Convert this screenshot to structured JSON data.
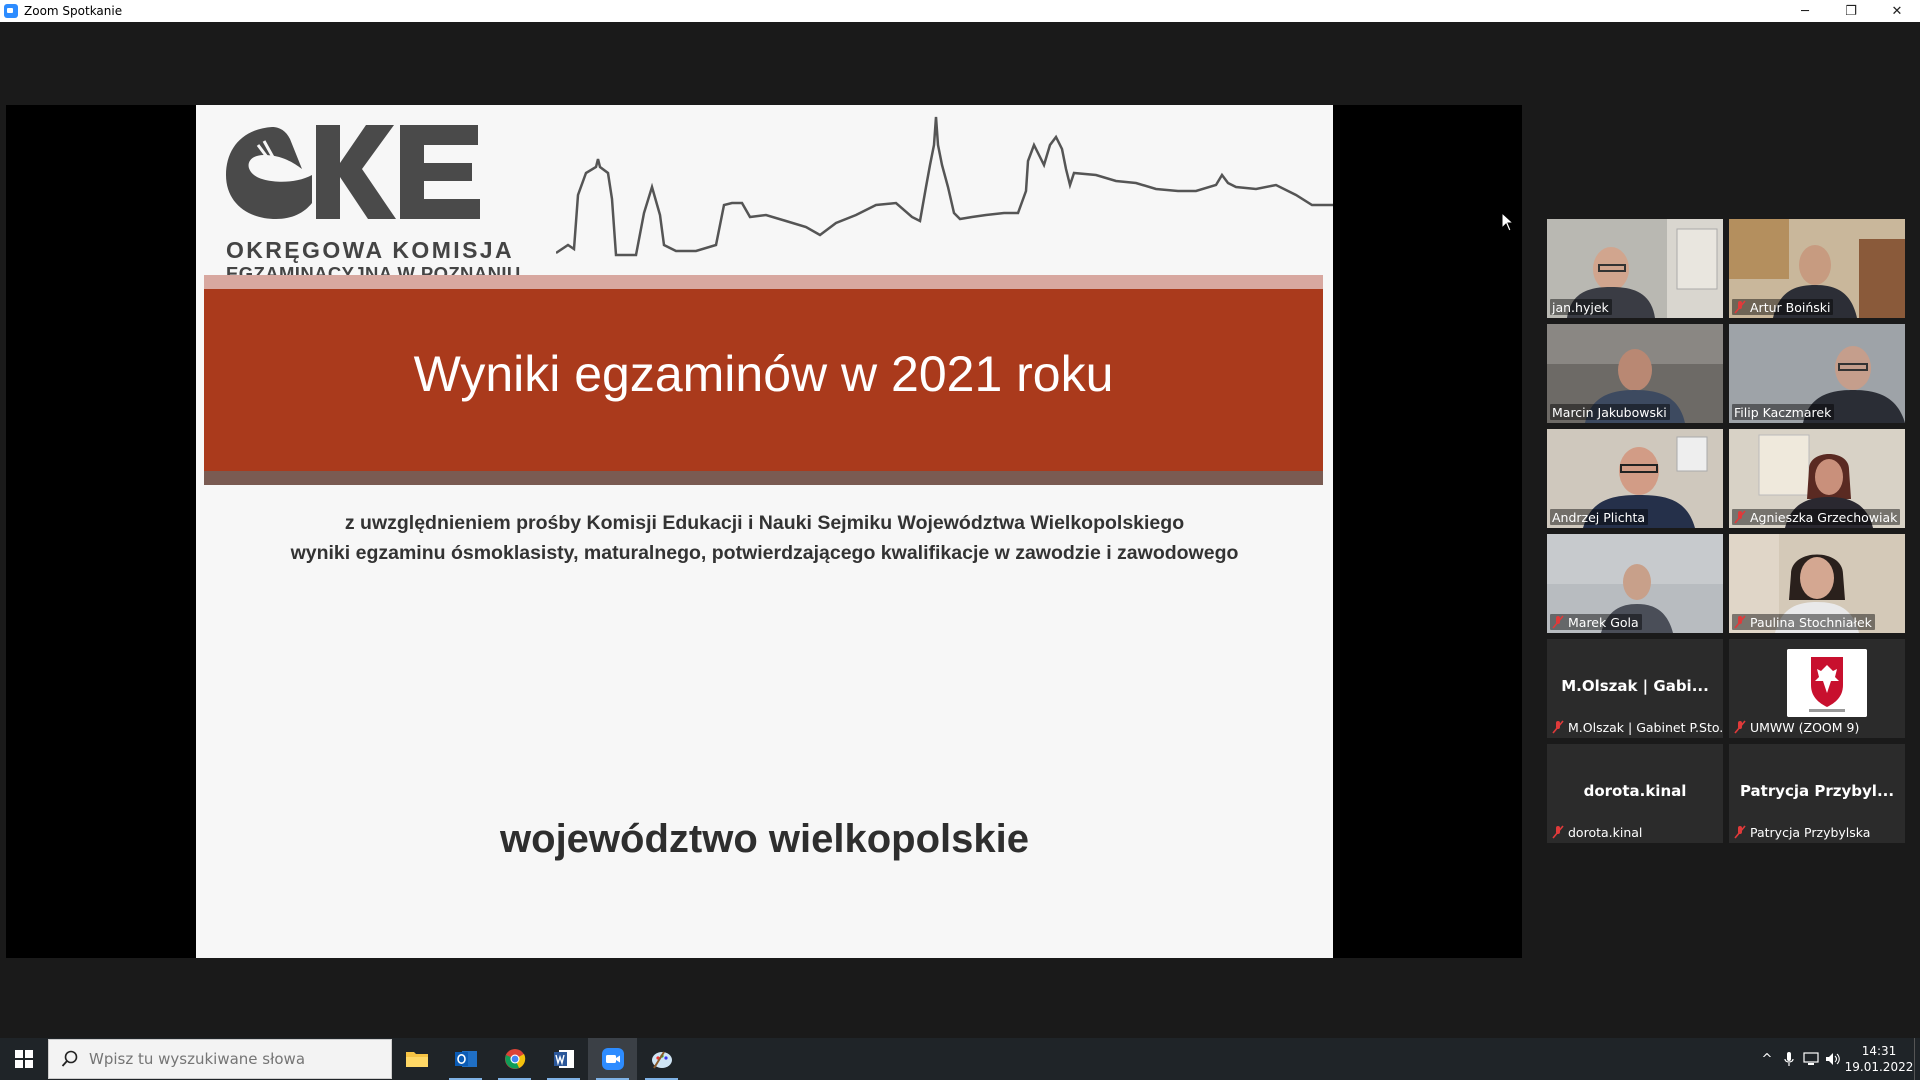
{
  "window": {
    "title": "Zoom Spotkanie",
    "minimize_icon": "─",
    "restore_icon": "❐",
    "close_icon": "✕"
  },
  "slide": {
    "logo_line1": "OKRĘGOWA KOMISJA",
    "logo_line2": "EGZAMINACYJNA W POZNANIU",
    "title": "Wyniki egzaminów w 2021 roku",
    "subtitle_line1": "z uwzględnieniem prośby Komisji Edukacji i Nauki Sejmiku Województwa Wielkopolskiego",
    "subtitle_line2": "wyniki egzaminu ósmoklasisty, maturalnego, potwierdzającego kwalifikacje w zawodzie i zawodowego",
    "region": "województwo wielkopolskie",
    "colors": {
      "band": "#aa3a1c",
      "logo": "#4a4a4a"
    }
  },
  "participants": [
    {
      "name": "jan.hyjek",
      "muted": false,
      "video": true,
      "active": false
    },
    {
      "name": "Artur Boiński",
      "muted": true,
      "video": true,
      "active": false
    },
    {
      "name": "Marcin Jakubowski",
      "muted": false,
      "video": true,
      "active": true
    },
    {
      "name": "Filip Kaczmarek",
      "muted": false,
      "video": true,
      "active": false
    },
    {
      "name": "Andrzej Plichta",
      "muted": false,
      "video": true,
      "active": false
    },
    {
      "name": "Agnieszka Grzechowiak",
      "muted": true,
      "video": true,
      "active": false
    },
    {
      "name": "Marek Gola",
      "muted": true,
      "video": true,
      "active": false
    },
    {
      "name": "Paulina Stochniałek",
      "muted": true,
      "video": true,
      "active": false
    },
    {
      "name": "M.Olszak | Gabinet P.Sto...",
      "display": "M.Olszak | Gabi...",
      "muted": true,
      "video": false,
      "active": false
    },
    {
      "name": "UMWW (ZOOM 9)",
      "muted": true,
      "video": false,
      "active": false,
      "avatar": "coat-of-arms"
    },
    {
      "name": "dorota.kinal",
      "display": "dorota.kinal",
      "muted": true,
      "video": false,
      "active": false
    },
    {
      "name": "Patrycja Przybylska",
      "display": "Patrycja Przybyl...",
      "muted": true,
      "video": false,
      "active": false
    }
  ],
  "taskbar": {
    "search_placeholder": "Wpisz tu wyszukiwane słowa",
    "apps": [
      "file-explorer",
      "outlook",
      "chrome",
      "word",
      "zoom",
      "paint"
    ],
    "time": "14:31",
    "date": "19.01.2022",
    "tray_chevron": "^"
  }
}
